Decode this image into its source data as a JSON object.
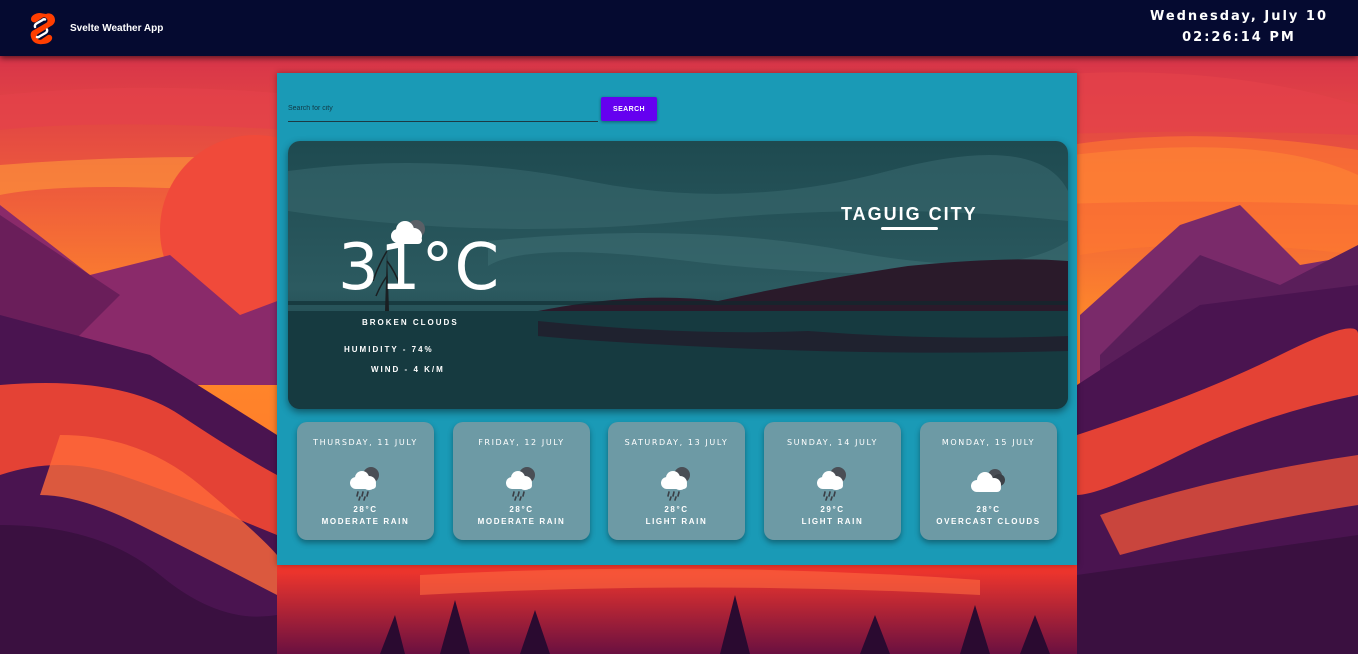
{
  "header": {
    "app_title": "Svelte Weather App",
    "logo_icon": "svelte-logo-icon",
    "date": "Wednesday, July 10",
    "time": "02:26:14 PM"
  },
  "search": {
    "placeholder": "Search for city",
    "value": "",
    "button_label": "SEARCH"
  },
  "current": {
    "temperature": "31°C",
    "condition": "BROKEN CLOUDS",
    "humidity": "HUMIDITY - 74%",
    "wind": "WIND - 4 K/M",
    "city": "TAGUIG CITY",
    "icon": "broken-clouds-icon"
  },
  "forecast": [
    {
      "day": "THURSDAY, 11 JULY",
      "temp": "28°C",
      "condition": "MODERATE RAIN",
      "icon": "rain-cloud-icon"
    },
    {
      "day": "FRIDAY, 12 JULY",
      "temp": "28°C",
      "condition": "MODERATE RAIN",
      "icon": "rain-cloud-icon"
    },
    {
      "day": "SATURDAY, 13 JULY",
      "temp": "28°C",
      "condition": "LIGHT RAIN",
      "icon": "rain-cloud-icon"
    },
    {
      "day": "SUNDAY, 14 JULY",
      "temp": "29°C",
      "condition": "LIGHT RAIN",
      "icon": "rain-cloud-icon"
    },
    {
      "day": "MONDAY, 15 JULY",
      "temp": "28°C",
      "condition": "OVERCAST CLOUDS",
      "icon": "overcast-clouds-icon"
    }
  ],
  "colors": {
    "header_bg": "#050a30",
    "panel_bg": "#1a9ab6",
    "search_button": "#6500f0",
    "forecast_card": "#6d9aa5"
  }
}
